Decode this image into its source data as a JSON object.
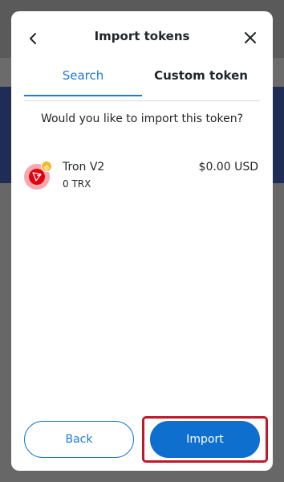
{
  "modal": {
    "title": "Import tokens",
    "back_icon": "chevron-left-icon",
    "close_icon": "close-icon"
  },
  "tabs": [
    {
      "label": "Search",
      "active": true
    },
    {
      "label": "Custom token",
      "active": false
    }
  ],
  "prompt": "Would you like to import this token?",
  "token": {
    "name": "Tron V2",
    "balance": "0 TRX",
    "fiat_value": "$0.00 USD",
    "icon": "tron-icon",
    "chain_badge_icon": "bnb-chain-icon"
  },
  "footer": {
    "back_label": "Back",
    "import_label": "Import"
  },
  "colors": {
    "accent": "#1f7ad1",
    "primary_button": "#0f6fce",
    "highlight": "#c0182a",
    "overlay": "#6b6b6b"
  }
}
